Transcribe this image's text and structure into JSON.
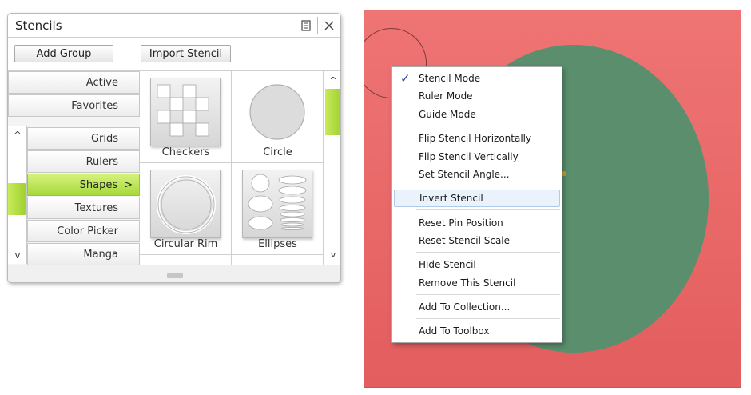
{
  "panel": {
    "title": "Stencils",
    "add_group_label": "Add Group",
    "import_label": "Import Stencil",
    "tabs": [
      "Active",
      "Favorites"
    ],
    "categories": [
      {
        "label": "Grids"
      },
      {
        "label": "Rulers"
      },
      {
        "label": "Shapes",
        "selected": true,
        "chevron": ">"
      },
      {
        "label": "Textures"
      },
      {
        "label": "Color Picker"
      },
      {
        "label": "Manga"
      }
    ],
    "stencils": [
      "Checkers",
      "Circle",
      "Circular Rim",
      "Ellipses"
    ],
    "scroll_up": "^",
    "scroll_down": "v",
    "accent_color": "#b5e04a"
  },
  "canvas": {
    "background_color": "#e86666",
    "stencil_color": "#5a8e6c"
  },
  "menu": {
    "groups": [
      [
        "Stencil Mode",
        "Ruler Mode",
        "Guide Mode"
      ],
      [
        "Flip Stencil Horizontally",
        "Flip Stencil Vertically",
        "Set Stencil Angle..."
      ],
      [
        "Invert Stencil"
      ],
      [
        "Reset Pin Position",
        "Reset Stencil Scale"
      ],
      [
        "Hide Stencil",
        "Remove This Stencil"
      ],
      [
        "Add To Collection..."
      ],
      [
        "Add To Toolbox"
      ]
    ],
    "checked_item": "Stencil Mode",
    "check_glyph": "✓",
    "highlighted_item": "Invert Stencil"
  }
}
